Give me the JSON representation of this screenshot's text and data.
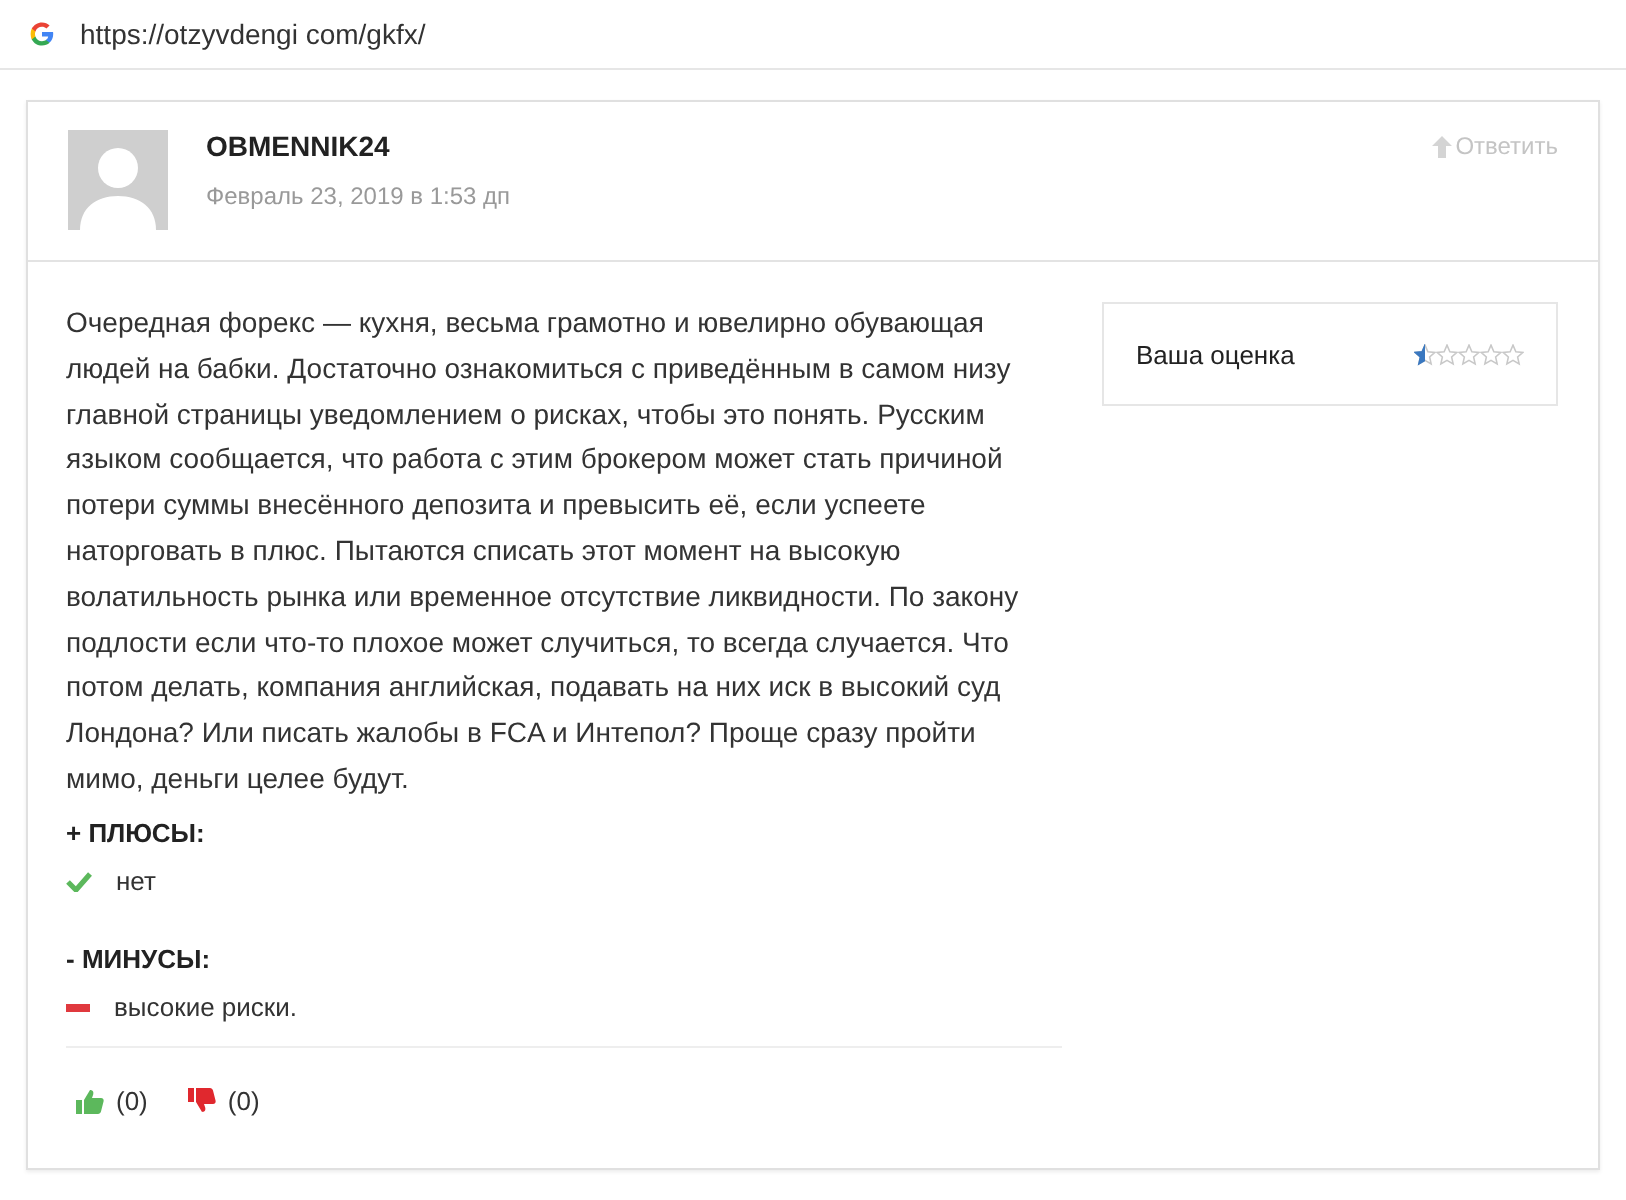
{
  "address_bar": {
    "url": "https://otzyvdengi com/gkfx/"
  },
  "comment": {
    "author": "OBMENNIK24",
    "date": "Февраль 23, 2019 в 1:53 дп",
    "reply": "Ответить",
    "text": "Очередная форекс — кухня, весьма грамотно и ювелирно обувающая людей на бабки. Достаточно ознакомиться с приведённым в самом низу главной страницы уведомлением о рисках, чтобы это понять. Русским языком сообщается, что работа с этим брокером может стать причиной потери суммы внесённого депозита и превысить её, если успеете наторговать в плюс. Пытаются списать этот момент на высокую волатильность рынка или временное отсутствие ликвидности. По закону подлости если что-то плохое может случиться, то всегда случается. Что потом делать, компания английская, подавать на них иск в высокий суд Лондона? Или писать жалобы в FCA и Интепол? Проще сразу пройти мимо, деньги целее будут.",
    "sections": [
      {
        "kind": "pros",
        "heading": "+ ПЛЮСЫ:",
        "items": [
          "нет"
        ]
      },
      {
        "kind": "cons",
        "heading": "- МИНУСЫ:",
        "items": [
          "высокие риски."
        ]
      }
    ],
    "votes": [
      {
        "kind": "up",
        "count": "(0)"
      },
      {
        "kind": "down",
        "count": "(0)"
      }
    ],
    "rating": {
      "label": "Ваша оценка",
      "stars": 0.5
    }
  }
}
